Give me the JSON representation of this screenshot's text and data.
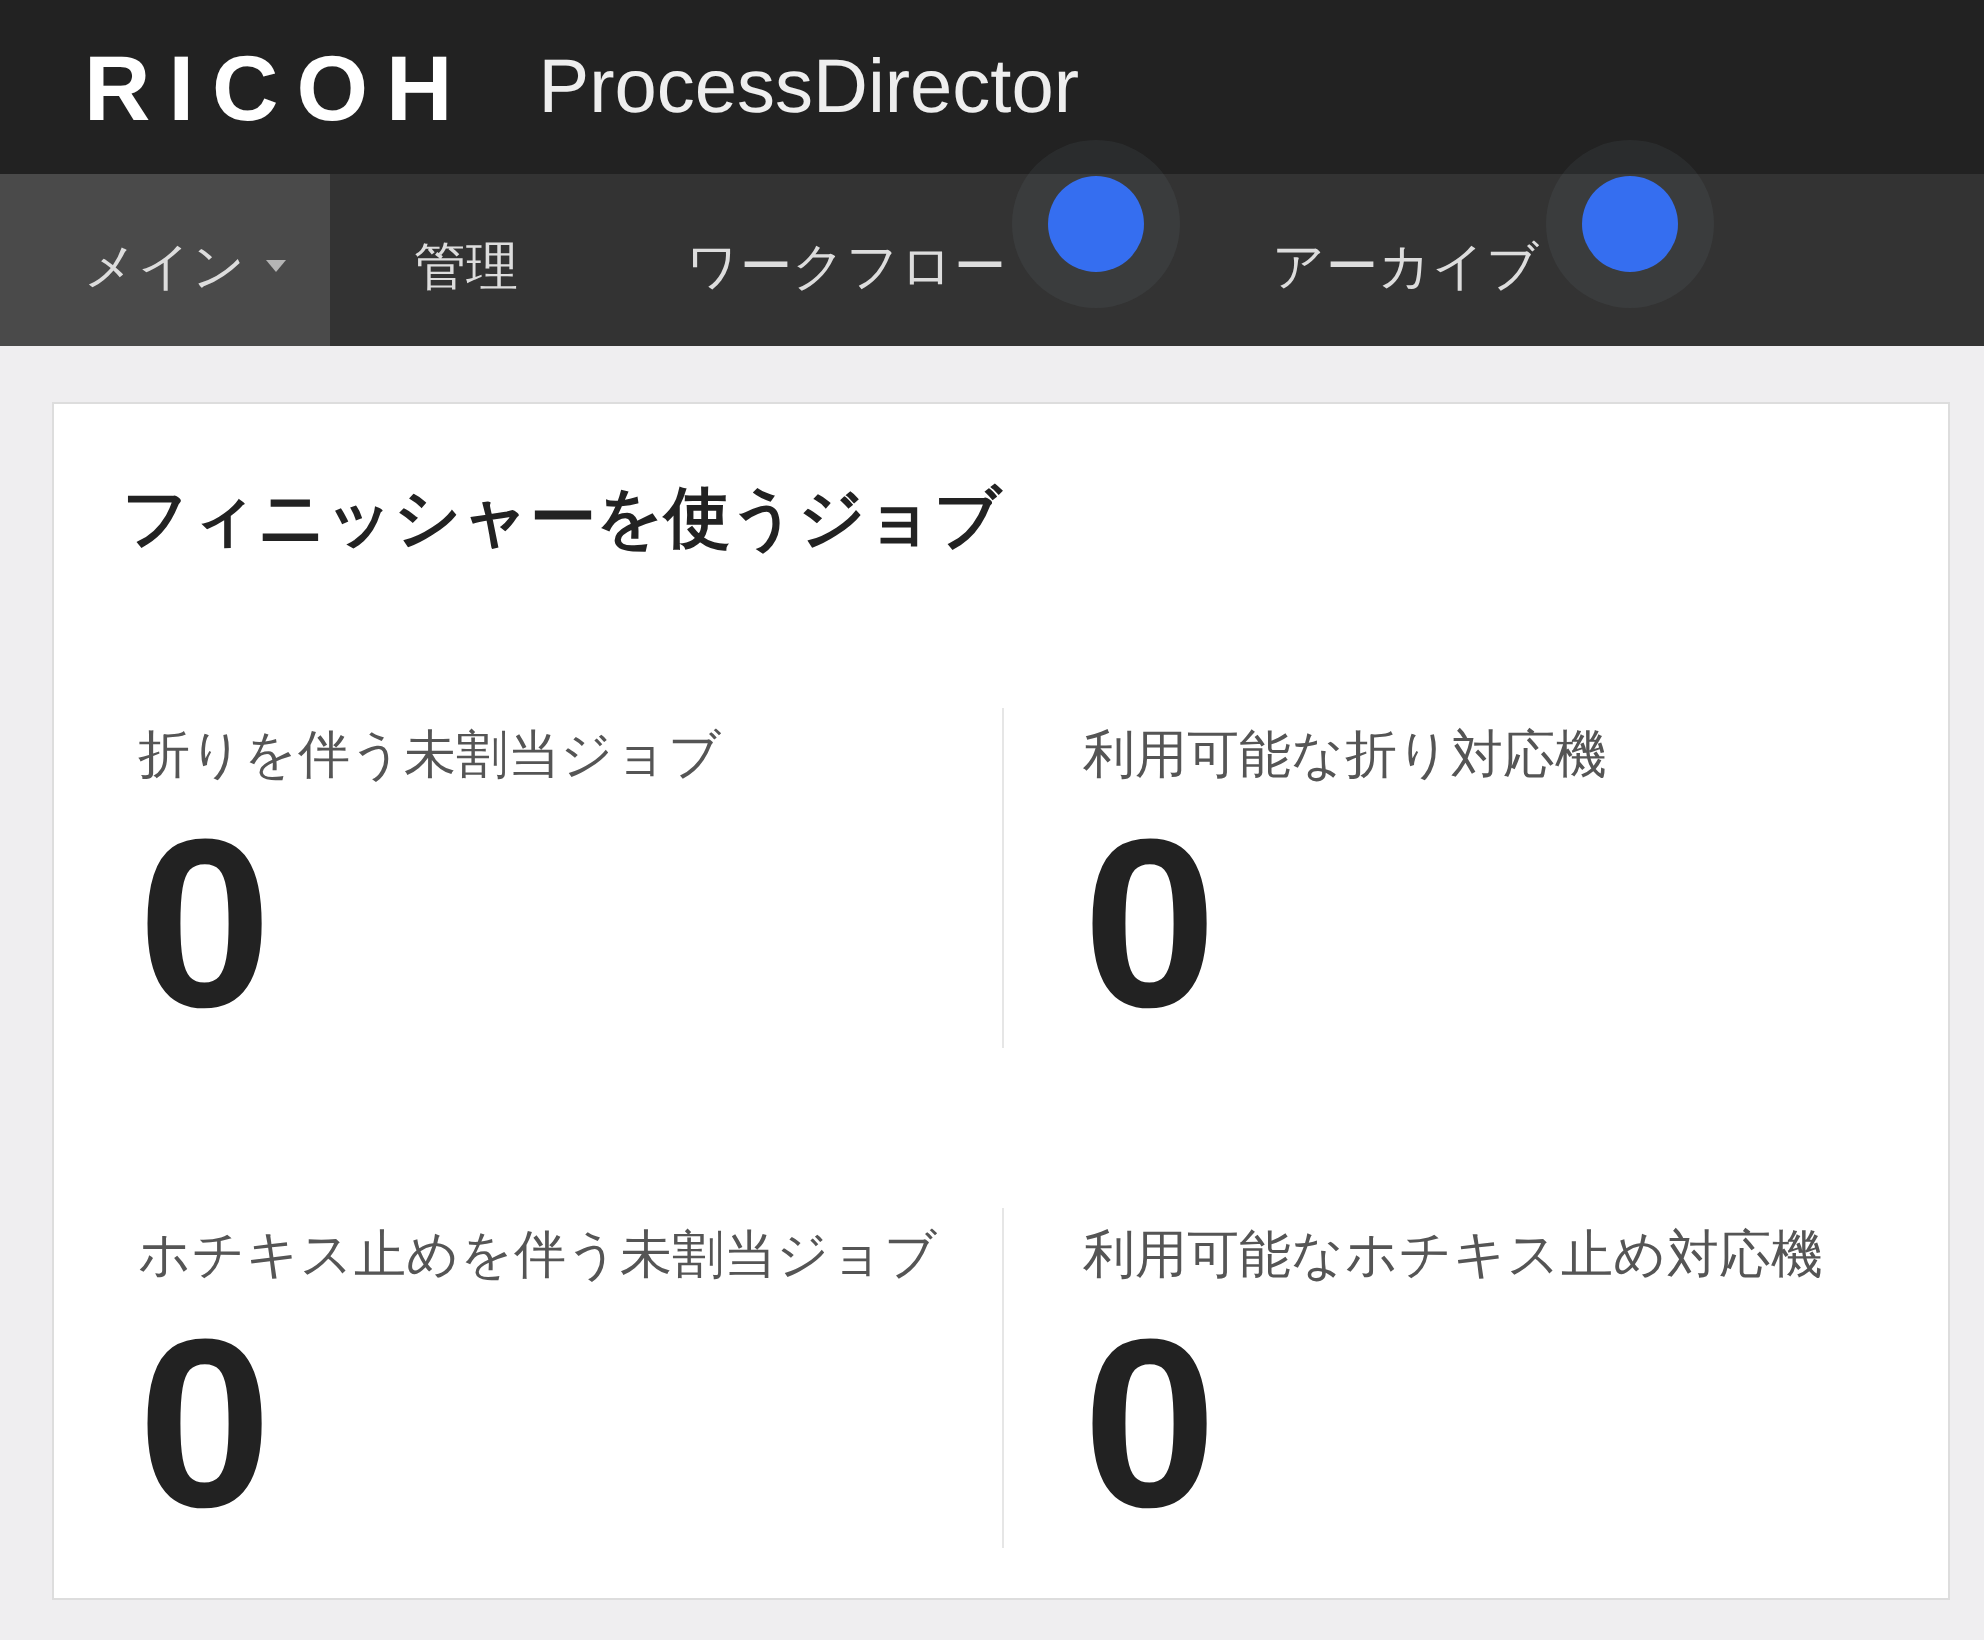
{
  "header": {
    "logo": "RICOH",
    "product": "ProcessDirector"
  },
  "nav": {
    "items": [
      {
        "label": "メイン",
        "selected": true,
        "dropdown": true,
        "hotspot": false
      },
      {
        "label": "管理",
        "selected": false,
        "dropdown": false,
        "hotspot": false
      },
      {
        "label": "ワークフロー",
        "selected": false,
        "dropdown": false,
        "hotspot": true
      },
      {
        "label": "アーカイブ",
        "selected": false,
        "dropdown": false,
        "hotspot": true
      }
    ]
  },
  "card": {
    "title": "フィニッシャーを使うジョブ",
    "metrics": [
      {
        "label": "折りを伴う未割当ジョブ",
        "value": "0"
      },
      {
        "label": "利用可能な折り対応機",
        "value": "0"
      },
      {
        "label": "ホチキス止めを伴う未割当ジョブ",
        "value": "0"
      },
      {
        "label": "利用可能なホチキス止め対応機",
        "value": "0"
      }
    ]
  }
}
